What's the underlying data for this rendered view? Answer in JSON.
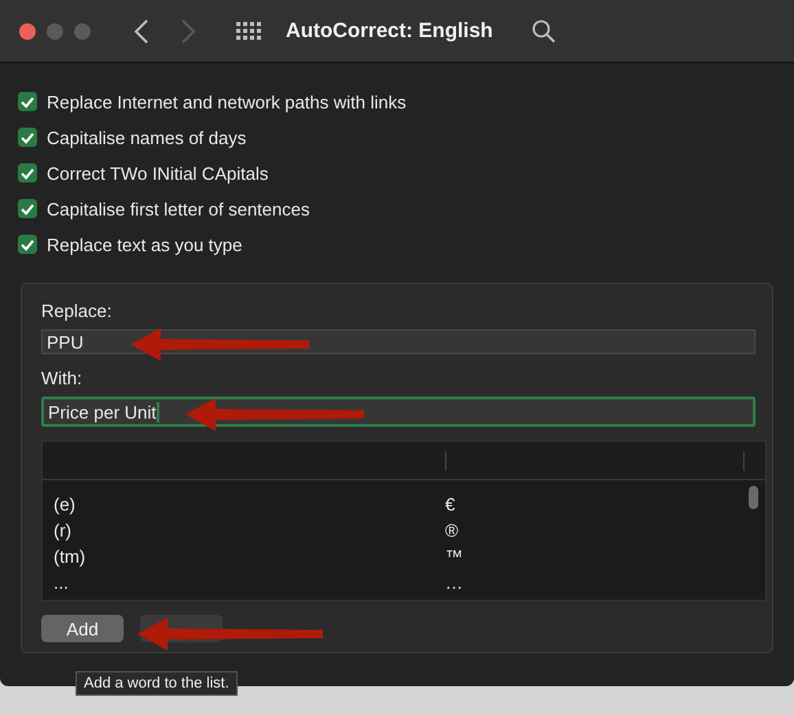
{
  "window": {
    "title": "AutoCorrect: English",
    "traffic_lights": [
      {
        "color": "#ec5f5a"
      },
      {
        "color": "#5a5a5a"
      },
      {
        "color": "#5a5a5a"
      }
    ],
    "back_disabled": false,
    "forward_disabled": true
  },
  "options": [
    {
      "label": "Replace Internet and network paths with links",
      "checked": true
    },
    {
      "label": "Capitalise names of days",
      "checked": true
    },
    {
      "label": "Correct TWo INitial CApitals",
      "checked": true
    },
    {
      "label": "Capitalise first letter of sentences",
      "checked": true
    },
    {
      "label": "Replace text as you type",
      "checked": true
    }
  ],
  "replace": {
    "label": "Replace:",
    "value": "PPU",
    "focused": false
  },
  "with": {
    "label": "With:",
    "value": "Price per Unit",
    "focused": true
  },
  "table": {
    "rows": [
      {
        "replace": "(e)",
        "with": "€"
      },
      {
        "replace": "(r)",
        "with": "®"
      },
      {
        "replace": "(tm)",
        "with": "™"
      },
      {
        "replace": "...",
        "with": "…"
      }
    ]
  },
  "buttons": [
    {
      "label": "Add",
      "disabled": false
    },
    {
      "disabled": true
    }
  ],
  "tooltip": "Add a word to the list.",
  "annotations": [
    {
      "kind": "arrow"
    },
    {
      "kind": "arrow"
    },
    {
      "kind": "arrow"
    }
  ]
}
